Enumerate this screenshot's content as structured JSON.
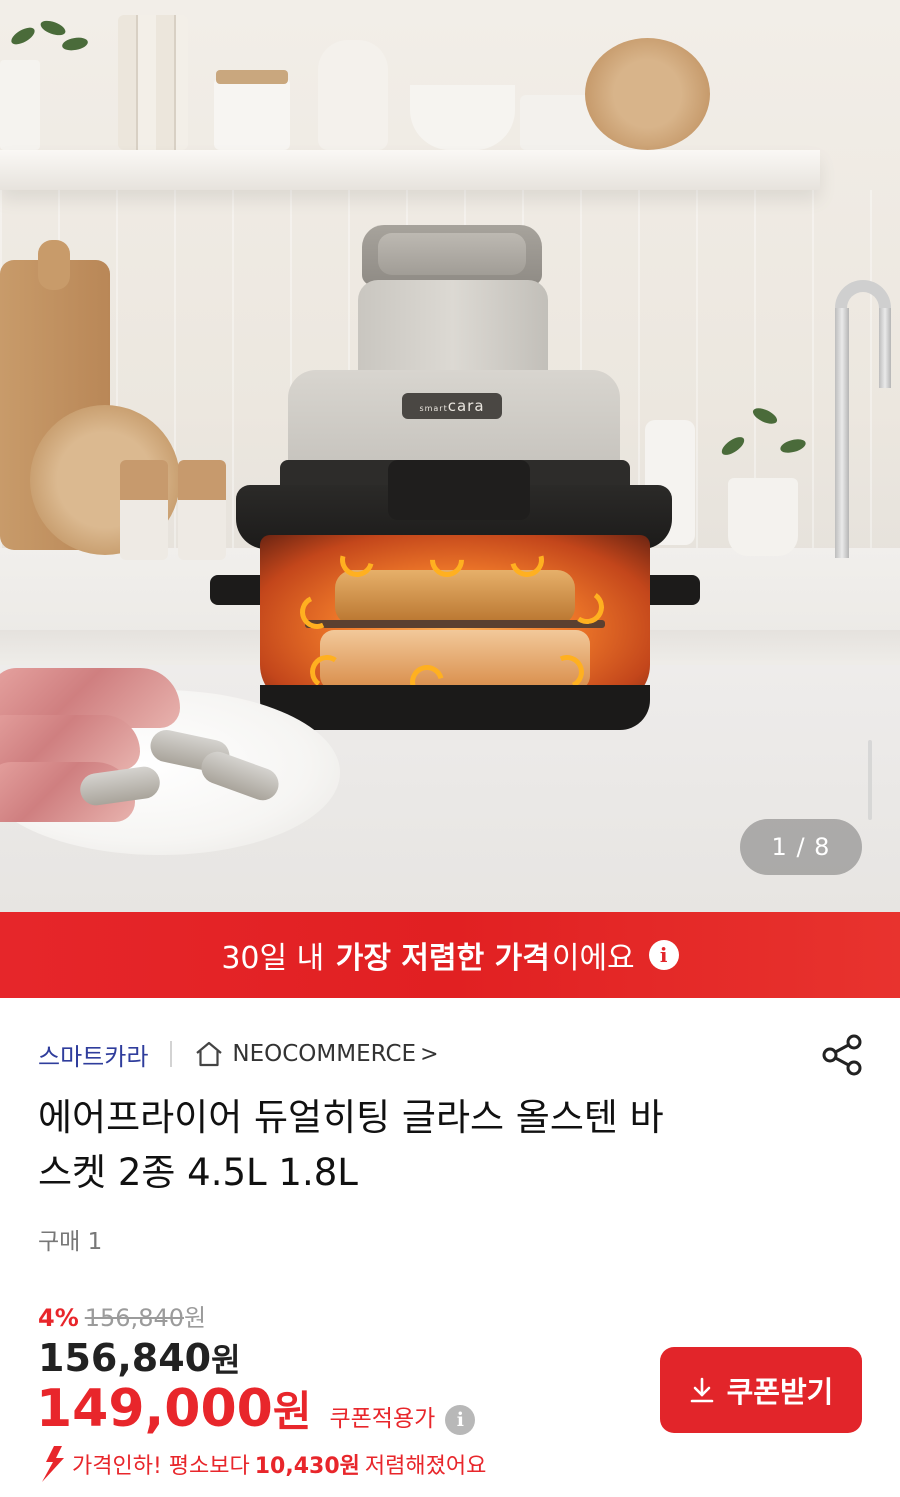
{
  "hero": {
    "product_brand_logo": "cara",
    "product_logo_prefix": "smart",
    "pager_current": "1",
    "pager_total": "8",
    "pager_text": "1 / 8"
  },
  "banner": {
    "prefix": "30일 내 ",
    "highlight": "가장 저렴한 가격",
    "suffix": "이에요",
    "icon": "info-icon",
    "bg_color": "#e2252a"
  },
  "product": {
    "brand": "스마트카라",
    "store": "NEOCOMMERCE",
    "store_icon": "home-icon",
    "store_chevron": ">",
    "share_icon": "share-icon",
    "title_line1": "에어프라이어 듀얼히팅 글라스 올스텐 바",
    "title_line2": "스켓 2종 4.5L 1.8L",
    "buy_count": "구매 1"
  },
  "pricing": {
    "discount_rate": "4%",
    "original_price": "156,840",
    "original_unit": "원",
    "sale_price": "156,840",
    "sale_unit": "원",
    "coupon_price": "149,000",
    "coupon_unit": "원",
    "coupon_label": "쿠폰적용가",
    "price_drop_prefix": "가격인하! 평소보다",
    "price_drop_amount": "10,430원",
    "price_drop_suffix": "저렴해졌어요",
    "accent_color": "#e8262b"
  },
  "actions": {
    "coupon_button": "쿠폰받기",
    "coupon_button_icon": "download-icon"
  }
}
